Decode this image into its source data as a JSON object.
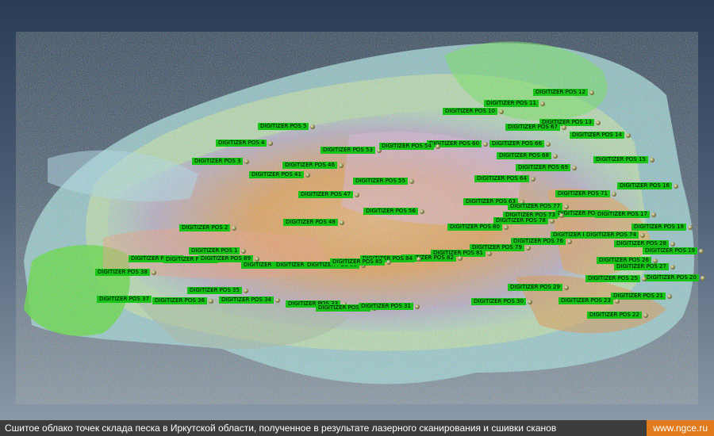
{
  "caption": "Сшитое облако точек склада песка в Иркутской области, полученное в результате лазерного сканирования и сшивки сканов",
  "site": "www.ngce.ru",
  "colors": {
    "label_bg": "#16c316",
    "footer_bg": "#3c3c3c",
    "site_bg": "#e07a1c",
    "sky_top": "#2a3d56"
  },
  "labels": [
    "DIGITIZER POS 12",
    "DIGITIZER POS 11",
    "DIGITIZER POS 10",
    "DIGITIZER POS 13",
    "DIGITIZER POS 67",
    "DIGITIZER POS 14",
    "DIGITIZER POS 60",
    "DIGITIZER POS 66",
    "DIGITIZER POS 68",
    "DIGITIZER POS 15",
    "DIGITIZER POS 69",
    "DIGITIZER POS 5",
    "DIGITIZER POS 4",
    "DIGITIZER POS 53",
    "DIGITIZER POS 54",
    "DIGITIZER POS 3",
    "DIGITIZER POS 46",
    "DIGITIZER POS 41",
    "DIGITIZER POS 55",
    "DIGITIZER POS 64",
    "DIGITIZER POS 16",
    "DIGITIZER POS 71",
    "DIGITIZER POS 47",
    "DIGITIZER POS 63",
    "DIGITIZER POS 77",
    "DIGITIZER POS 72",
    "DIGITIZER POS 56",
    "DIGITIZER POS 73",
    "DIGITIZER POS 17",
    "DIGITIZER POS 48",
    "DIGITIZER POS 78",
    "DIGITIZER POS 18",
    "DIGITIZER POS 80",
    "DIGITIZER POS 2",
    "DIGITIZER POS 75",
    "DIGITIZER POS 74",
    "DIGITIZER POS 76",
    "DIGITIZER POS 28",
    "DIGITIZER POS 79",
    "DIGITIZER POS 19",
    "DIGITIZER POS 1",
    "DIGITIZER POS 81",
    "DIGITIZER POS 82",
    "DIGITIZER POS 84",
    "DIGITIZER POS 26",
    "DIGITIZER POS 91",
    "DIGITIZER POS 90",
    "DIGITIZER POS 89",
    "DIGITIZER POS 88",
    "DIGITIZER POS 87",
    "DIGITIZER POS 86",
    "DIGITIZER POS 85",
    "DIGITIZER POS 27",
    "DIGITIZER POS 38",
    "DIGITIZER POS 20",
    "DIGITIZER POS 25",
    "DIGITIZER POS 29",
    "DIGITIZER POS 35",
    "DIGITIZER POS 21",
    "DIGITIZER POS 37",
    "DIGITIZER POS 36",
    "DIGITIZER POS 34",
    "DIGITIZER POS 33",
    "DIGITIZER POS 30",
    "DIGITIZER POS 23",
    "DIGITIZER POS 32",
    "DIGITIZER POS 31",
    "DIGITIZER POS 22"
  ]
}
